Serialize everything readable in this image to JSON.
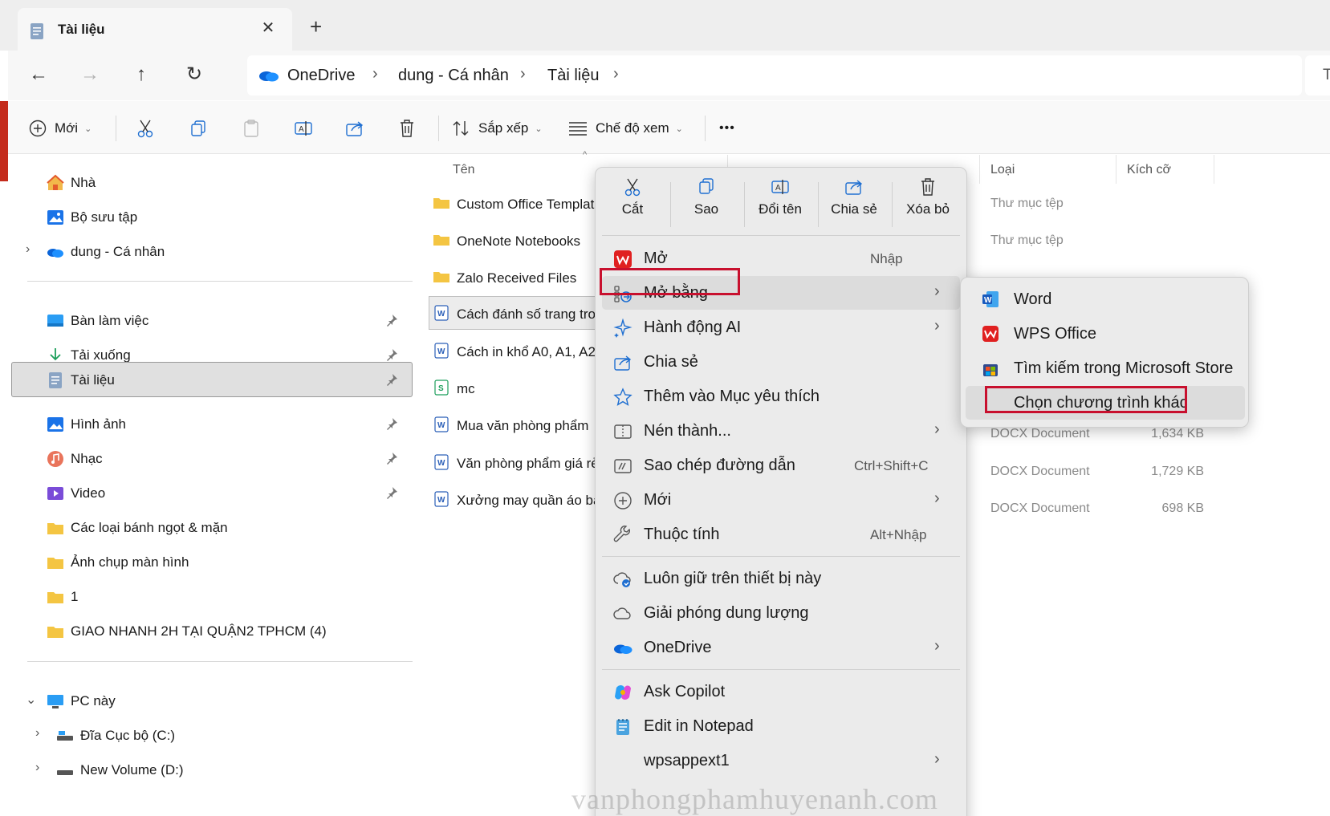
{
  "tab": {
    "title": "Tài liệu",
    "close": "✕",
    "new_tab": "+"
  },
  "nav_buttons": {
    "back": "←",
    "forward": "→",
    "up": "↑",
    "refresh": "↻"
  },
  "breadcrumb": {
    "items": [
      "OneDrive",
      "dung - Cá nhân",
      "Tài liệu"
    ],
    "sep": "›"
  },
  "search": {
    "text": "Ti"
  },
  "toolbar": {
    "new_label": "Mới",
    "sort_label": "Sắp xếp",
    "view_label": "Chế độ xem",
    "more_label": "•••",
    "caret": "⌄"
  },
  "sidebar": {
    "top": [
      {
        "label": "Nhà",
        "icon": "home-icon"
      },
      {
        "label": "Bộ sưu tập",
        "icon": "gallery-icon"
      },
      {
        "label": "dung - Cá nhân",
        "icon": "onedrive-icon",
        "chevron": "›"
      }
    ],
    "pinned": [
      {
        "label": "Bàn làm việc",
        "icon": "desktop-icon"
      },
      {
        "label": "Tải xuống",
        "icon": "download-icon"
      },
      {
        "label": "Tài liệu",
        "icon": "document-icon"
      },
      {
        "label": "Hình ảnh",
        "icon": "pictures-icon"
      },
      {
        "label": "Nhạc",
        "icon": "music-icon"
      },
      {
        "label": "Video",
        "icon": "video-icon"
      }
    ],
    "folders": [
      "Các loại bánh ngọt & mặn",
      "Ảnh chụp màn hình",
      "1",
      "GIAO NHANH 2H TẠI QUẬN2 TPHCM (4)"
    ],
    "pc": {
      "label": "PC này",
      "chevron": "⌄"
    },
    "drives": [
      {
        "label": "Đĩa Cục bộ (C:)",
        "chevron": "›"
      },
      {
        "label": "New Volume (D:)",
        "chevron": "›"
      }
    ]
  },
  "file_list": {
    "columns": {
      "name": "Tên",
      "type": "Loại",
      "size": "Kích cỡ"
    },
    "rows": [
      {
        "name": "Custom Office Templates",
        "kind": "folder",
        "type": "Thư mục tệp",
        "size": ""
      },
      {
        "name": "OneNote Notebooks",
        "kind": "folder",
        "type": "Thư mục tệp",
        "size": ""
      },
      {
        "name": "Zalo Received Files",
        "kind": "folder",
        "type": "",
        "size": ""
      },
      {
        "name": "Cách đánh số trang trong Word",
        "kind": "word",
        "type": "",
        "size": ""
      },
      {
        "name": "Cách in khổ A0, A1, A2",
        "kind": "word",
        "type": "",
        "size": ""
      },
      {
        "name": "mc",
        "kind": "sheet",
        "type": "",
        "size": ""
      },
      {
        "name": "Mua văn phòng phẩm",
        "kind": "word",
        "type": "DOCX Document",
        "size": "1,634 KB"
      },
      {
        "name": "Văn phòng phẩm giá rẻ",
        "kind": "word",
        "type": "DOCX Document",
        "size": "1,729 KB"
      },
      {
        "name": "Xưởng may quần áo bảo hộ",
        "kind": "word",
        "type": "DOCX Document",
        "size": "698 KB"
      }
    ]
  },
  "context_menu": {
    "quick_actions": [
      "Cắt",
      "Sao",
      "Đổi tên",
      "Chia sẻ",
      "Xóa bỏ"
    ],
    "items": [
      {
        "label": "Mở",
        "shortcut": "Nhập"
      },
      {
        "label": "Mở bằng",
        "submenu": true
      },
      {
        "label": "Hành động AI",
        "submenu": true
      },
      {
        "label": "Chia sẻ"
      },
      {
        "label": "Thêm vào Mục yêu thích"
      },
      {
        "label": "Nén thành...",
        "submenu": true
      },
      {
        "label": "Sao chép đường dẫn",
        "shortcut": "Ctrl+Shift+C"
      },
      {
        "label": "Mới",
        "submenu": true
      },
      {
        "label": "Thuộc tính",
        "shortcut": "Alt+Nhập"
      },
      {
        "label": "Luôn giữ trên thiết bị này"
      },
      {
        "label": "Giải phóng dung lượng"
      },
      {
        "label": "OneDrive",
        "submenu": true
      },
      {
        "label": "Ask Copilot"
      },
      {
        "label": "Edit in Notepad"
      },
      {
        "label": "wpsappext1",
        "submenu": true
      }
    ],
    "arrow": "›"
  },
  "submenu": {
    "items": [
      "Word",
      "WPS Office",
      "Tìm kiếm trong Microsoft Store",
      "Chọn chương trình khác"
    ]
  },
  "watermark": "vanphongphamhuyenanh.com",
  "colors": {
    "accent": "#0067c0",
    "highlight_box": "#c8102e",
    "wps_red": "#e02020",
    "folder": "#f4c542"
  }
}
